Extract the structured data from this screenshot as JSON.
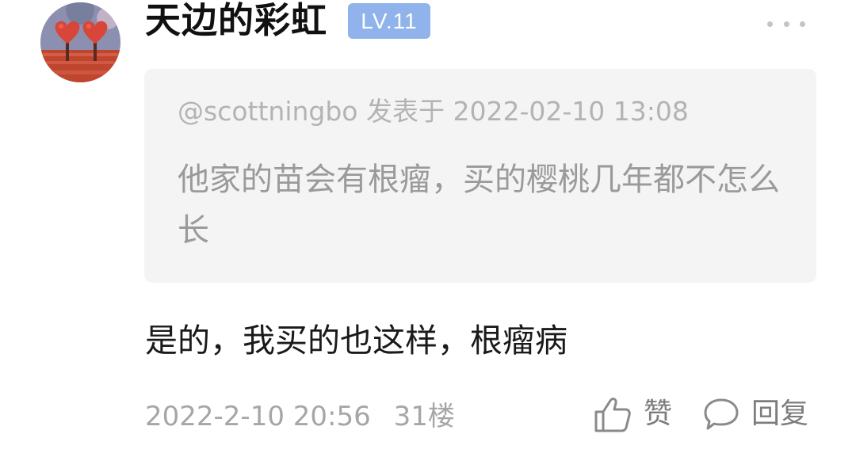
{
  "user": {
    "name": "天边的彩虹",
    "level": "LV.11"
  },
  "quote": {
    "meta": "@scottningbo 发表于 2022-02-10 13:08",
    "text": "他家的苗会有根瘤，买的樱桃几年都不怎么长"
  },
  "reply": {
    "text": "是的，我买的也这样，根瘤病"
  },
  "footer": {
    "timestamp": "2022-2-10 20:56",
    "floor": "31楼",
    "like_label": "赞",
    "reply_label": "回复"
  },
  "icons": {
    "more": "more-dots-icon",
    "like": "thumbs-up-icon",
    "reply": "comment-bubble-icon"
  },
  "colors": {
    "level_badge": "#8fb3ea",
    "quote_background": "#f4f4f4"
  }
}
